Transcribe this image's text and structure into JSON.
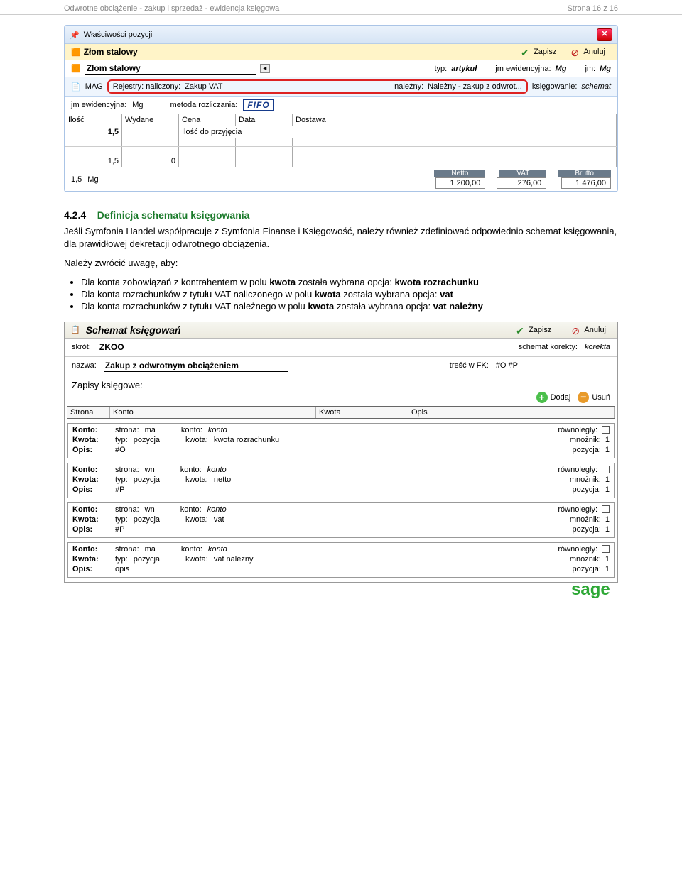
{
  "page_header": {
    "left": "Odwrotne obciążenie - zakup i sprzedaż - ewidencja księgowa",
    "right": "Strona 16 z 16"
  },
  "win1": {
    "title": "Właściwości pozycji",
    "item_name": "Złom stalowy",
    "save": "Zapisz",
    "cancel": "Anuluj",
    "typ_lbl": "typ:",
    "typ_val": "artykuł",
    "jm_ewid_lbl": "jm ewidencyjna:",
    "jm_ewid_val": "Mg",
    "jm_lbl": "jm:",
    "jm_val": "Mg",
    "mag_lbl": "MAG",
    "reg_lbl": "Rejestry: naliczony:",
    "reg_val1": "Zakup VAT",
    "nalezny_lbl": "należny:",
    "nalezny_val": "Należny - zakup z odwrot...",
    "ksieg_lbl": "księgowanie:",
    "ksieg_val": "schemat",
    "jm_ewid2_lbl": "jm ewidencyjna:",
    "jm_ewid2_val": "Mg",
    "metoda_lbl": "metoda rozliczania:",
    "metoda_val": "FIFO",
    "cols": {
      "c1": "Ilość",
      "c2": "Wydane",
      "c3": "Cena",
      "c4": "Data",
      "c5": "Dostawa"
    },
    "row_accept_val": "1,5",
    "row_accept_lbl": "Ilość do przyjęcia",
    "row_sum_a": "1,5",
    "row_sum_b": "0",
    "footer_a": "1,5",
    "footer_b": "Mg",
    "netto_lbl": "Netto",
    "netto_val": "1 200,00",
    "vat_lbl": "VAT",
    "vat_val": "276,00",
    "brutto_lbl": "Brutto",
    "brutto_val": "1 476,00"
  },
  "section": {
    "num": "4.2.4",
    "title": "Definicja schematu księgowania",
    "p1a": "Jeśli Symfonia Handel współpracuje z Symfonia Finanse i Księgowość, należy również zdefiniować odpowiednio schemat księgowania, dla prawidłowej dekretacji odwrotnego obciążenia.",
    "p2": "Należy zwrócić uwagę, aby:",
    "b1a": "Dla konta zobowiązań z kontrahentem w polu ",
    "b1b": "kwota",
    "b1c": " została wybrana opcja: ",
    "b1d": "kwota rozrachunku",
    "b2a": "Dla konta rozrachunków z tytułu VAT naliczonego w polu ",
    "b2b": "kwota",
    "b2c": " została wybrana opcja: ",
    "b2d": "vat",
    "b3a": "Dla konta rozrachunków z tytułu VAT należnego w polu ",
    "b3b": "kwota",
    "b3c": " została wybrana opcja: ",
    "b3d": "vat należny"
  },
  "sch": {
    "title": "Schemat księgowań",
    "save": "Zapisz",
    "cancel": "Anuluj",
    "skrot_lbl": "skrót:",
    "skrot_val": "ZKOO",
    "korekta_lbl": "schemat korekty:",
    "korekta_val": "korekta",
    "nazwa_lbl": "nazwa:",
    "nazwa_val": "Zakup z odwrotnym obciążeniem",
    "tresc_lbl": "treść w FK:",
    "tresc_val": "#O #P",
    "zapisy": "Zapisy księgowe:",
    "dodaj": "Dodaj",
    "usun": "Usuń",
    "hdr": {
      "c1": "Strona",
      "c2": "Konto",
      "c3": "Kwota",
      "c4": "Opis"
    },
    "common": {
      "konto_lbl": "Konto:",
      "kwota_lbl": "Kwota:",
      "opis_lbl": "Opis:",
      "strona_lbl": "strona:",
      "konto_s_lbl": "konto:",
      "konto_v": "konto",
      "typ_lbl": "typ:",
      "typ_v": "pozycja",
      "kwota_s_lbl": "kwota:",
      "rown_lbl": "równoległy:",
      "mnoz_lbl": "mnożnik:",
      "mnoz_v": "1",
      "poz_lbl": "pozycja:",
      "poz_v": "1"
    },
    "e1": {
      "strona": "ma",
      "kwota": "kwota rozrachunku",
      "opis": "#O"
    },
    "e2": {
      "strona": "wn",
      "kwota": "netto",
      "opis": "#P"
    },
    "e3": {
      "strona": "wn",
      "kwota": "vat",
      "opis": "#P"
    },
    "e4": {
      "strona": "ma",
      "kwota": "vat należny",
      "opis": "opis"
    }
  },
  "logo": "sage"
}
